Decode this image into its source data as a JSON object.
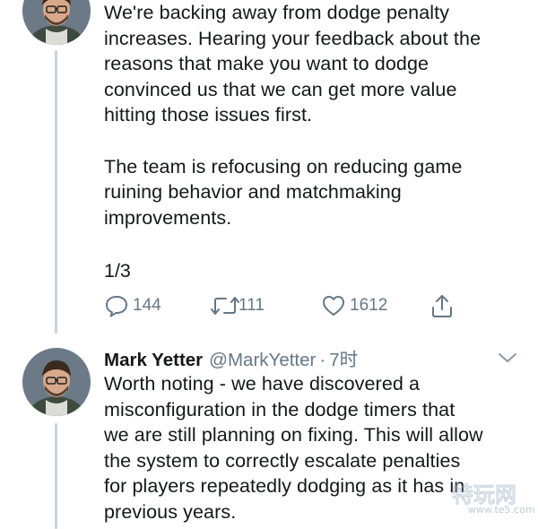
{
  "tweet1": {
    "text": "We're backing away from dodge penalty\nincreases. Hearing your feedback about the\nreasons that make you want to dodge\nconvinced us that we can get more value\nhitting those issues first.\n\nThe team is refocusing on reducing game\nruining behavior and matchmaking\nimprovements.",
    "thread_counter": "1/3",
    "actions": {
      "reply_icon": "reply-icon",
      "reply_count": "144",
      "retweet_icon": "retweet-icon",
      "retweet_count": "111",
      "like_icon": "heart-icon",
      "like_count": "1612",
      "share_icon": "share-icon"
    }
  },
  "tweet2": {
    "author_name": "Mark Yetter",
    "author_handle": "@MarkYetter",
    "separator": "·",
    "time": "7时",
    "text": "Worth noting - we have discovered a\nmisconfiguration in the dodge timers that\nwe are still planning on fixing. This will allow\nthe system to correctly escalate penalties\nfor players repeatedly dodging as it has in\nprevious years.",
    "menu_icon": "chevron-down-icon"
  },
  "watermark": {
    "text": "www.te5.com"
  },
  "colors": {
    "text": "#14171a",
    "secondary": "#657786",
    "thread_line": "#c7d3dc",
    "background": "#ffffff"
  }
}
